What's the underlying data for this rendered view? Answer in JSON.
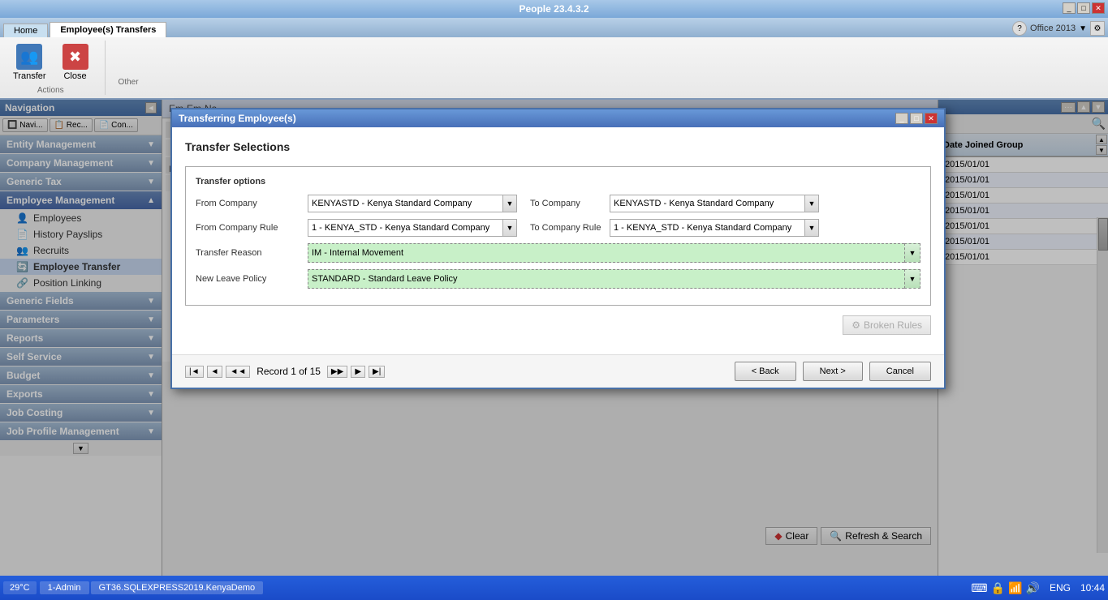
{
  "app": {
    "title": "People 23.4.3.2",
    "office_label": "Office 2013",
    "time": "10:44",
    "language": "ENG",
    "temperature": "29°C"
  },
  "ribbon": {
    "tabs": [
      {
        "label": "Home",
        "active": false
      },
      {
        "label": "Employee(s) Transfers",
        "active": true
      }
    ],
    "actions_group": {
      "label": "Actions",
      "buttons": [
        {
          "label": "Transfer",
          "icon": "👥"
        },
        {
          "label": "Close",
          "icon": "✖"
        }
      ]
    },
    "other_group": {
      "label": "Other"
    }
  },
  "sidebar": {
    "title": "Navigation",
    "nav_buttons": [
      {
        "label": "Navi...",
        "icon": "🔲"
      },
      {
        "label": "Rec...",
        "icon": "📋"
      },
      {
        "label": "Con...",
        "icon": "📄"
      }
    ],
    "items": [
      {
        "label": "Entity Management",
        "active": false,
        "expanded": false
      },
      {
        "label": "Company Management",
        "active": false,
        "expanded": false
      },
      {
        "label": "Generic Tax",
        "active": false,
        "expanded": false
      },
      {
        "label": "Employee Management",
        "active": true,
        "expanded": true
      },
      {
        "label": "Generic Fields",
        "active": false,
        "expanded": false
      },
      {
        "label": "Parameters",
        "active": false,
        "expanded": false
      },
      {
        "label": "Reports",
        "active": false,
        "expanded": false
      },
      {
        "label": "Self Service",
        "active": false,
        "expanded": false
      },
      {
        "label": "Budget",
        "active": false,
        "expanded": false
      },
      {
        "label": "Exports",
        "active": false,
        "expanded": false
      },
      {
        "label": "Job Costing",
        "active": false,
        "expanded": false
      },
      {
        "label": "Job Profile Management",
        "active": false,
        "expanded": false
      }
    ],
    "employee_management_sub": [
      {
        "label": "Employees",
        "icon": "👤",
        "active": false
      },
      {
        "label": "History Payslips",
        "icon": "📄",
        "active": false
      },
      {
        "label": "Recruits",
        "icon": "👥",
        "active": false
      },
      {
        "label": "Employee Transfer",
        "icon": "🔄",
        "active": true
      },
      {
        "label": "Position Linking",
        "icon": "🔗",
        "active": false
      }
    ]
  },
  "modal": {
    "title": "Transferring Employee(s)",
    "section_title": "Transfer Selections",
    "section_box_title": "Transfer options",
    "form": {
      "from_company_label": "From Company",
      "from_company_value": "KENYASTD - Kenya Standard Company",
      "to_company_label": "To Company",
      "to_company_value": "KENYASTD - Kenya Standard Company",
      "from_company_rule_label": "From Company Rule",
      "from_company_rule_value": "1 - KENYA_STD - Kenya Standard Company",
      "to_company_rule_label": "To Company Rule",
      "to_company_rule_value": "1 - KENYA_STD - Kenya Standard Company",
      "transfer_reason_label": "Transfer Reason",
      "transfer_reason_value": "IM - Internal Movement",
      "new_leave_policy_label": "New Leave Policy",
      "new_leave_policy_value": "STANDARD - Standard Leave Policy"
    },
    "broken_rules_btn": "Broken Rules",
    "buttons": {
      "back": "< Back",
      "next": "Next >",
      "cancel": "Cancel"
    },
    "record_info": "Record 1 of 15"
  },
  "right_panel": {
    "column_header": "Date Joined Group",
    "dates": [
      "2015/01/01",
      "2015/01/01",
      "2015/01/01",
      "2015/01/01",
      "2015/01/01",
      "2015/01/01",
      "2015/01/01"
    ]
  },
  "taskbar": {
    "start_label": "29°C",
    "items": [
      {
        "label": "1-Admin"
      },
      {
        "label": "GT36.SQLEXPRESS2019.KenyaDemo"
      }
    ],
    "time": "10:44",
    "language": "ENG"
  }
}
